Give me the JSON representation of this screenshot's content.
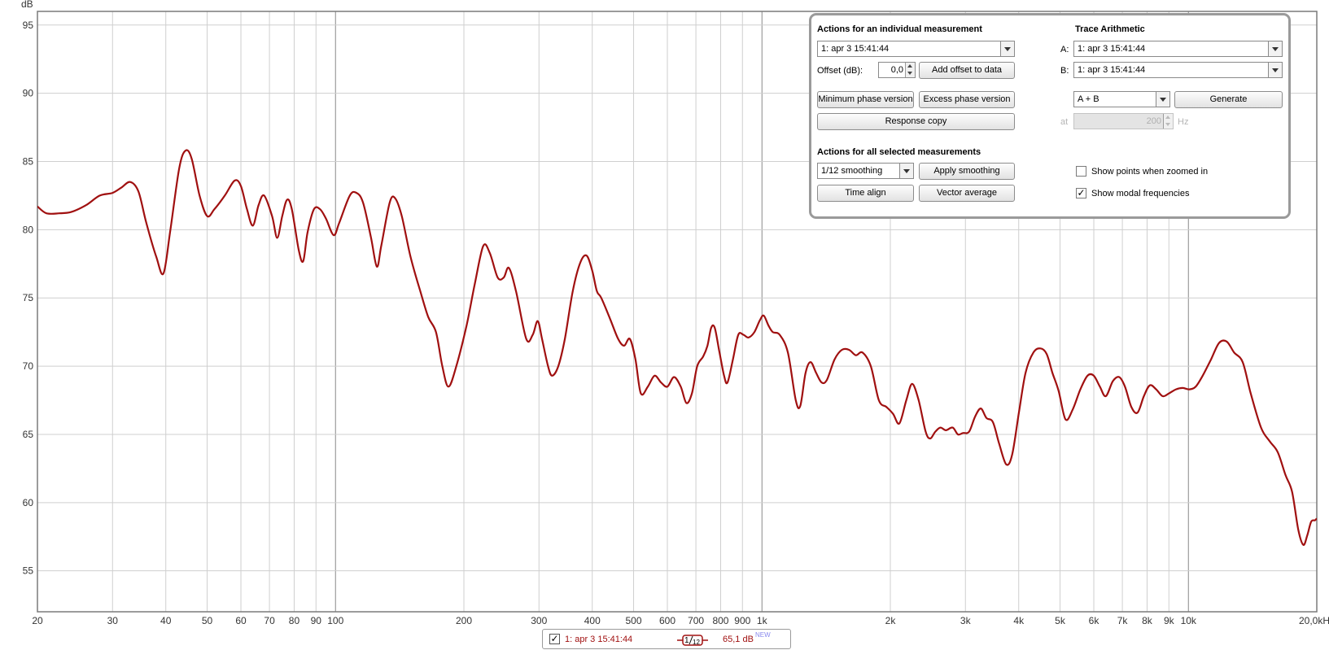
{
  "chart_data": {
    "type": "line",
    "title": "",
    "xlabel": "",
    "ylabel": "dB",
    "xscale": "log",
    "xlim": [
      20,
      20000
    ],
    "ylim": [
      52,
      96
    ],
    "grid": true,
    "x_tick_labels": [
      {
        "v": 20,
        "t": "20"
      },
      {
        "v": 30,
        "t": "30"
      },
      {
        "v": 40,
        "t": "40"
      },
      {
        "v": 50,
        "t": "50"
      },
      {
        "v": 60,
        "t": "60"
      },
      {
        "v": 70,
        "t": "70"
      },
      {
        "v": 80,
        "t": "80"
      },
      {
        "v": 90,
        "t": "90"
      },
      {
        "v": 100,
        "t": "100"
      },
      {
        "v": 200,
        "t": "200"
      },
      {
        "v": 300,
        "t": "300"
      },
      {
        "v": 400,
        "t": "400"
      },
      {
        "v": 500,
        "t": "500"
      },
      {
        "v": 600,
        "t": "600"
      },
      {
        "v": 700,
        "t": "700"
      },
      {
        "v": 800,
        "t": "800"
      },
      {
        "v": 900,
        "t": "900"
      },
      {
        "v": 1000,
        "t": "1k"
      },
      {
        "v": 2000,
        "t": "2k"
      },
      {
        "v": 3000,
        "t": "3k"
      },
      {
        "v": 4000,
        "t": "4k"
      },
      {
        "v": 5000,
        "t": "5k"
      },
      {
        "v": 6000,
        "t": "6k"
      },
      {
        "v": 7000,
        "t": "7k"
      },
      {
        "v": 8000,
        "t": "8k"
      },
      {
        "v": 9000,
        "t": "9k"
      },
      {
        "v": 10000,
        "t": "10k"
      },
      {
        "v": 20000,
        "t": "20,0kHz"
      }
    ],
    "y_ticks": [
      55,
      60,
      65,
      70,
      75,
      80,
      85,
      90,
      95
    ],
    "series": [
      {
        "name": "1: apr 3 15:41:44",
        "color": "#a01010",
        "points": [
          [
            20,
            81.7
          ],
          [
            21,
            81.2
          ],
          [
            22.5,
            81.2
          ],
          [
            24,
            81.3
          ],
          [
            26,
            81.8
          ],
          [
            28,
            82.5
          ],
          [
            30,
            82.7
          ],
          [
            31.5,
            83.1
          ],
          [
            33,
            83.5
          ],
          [
            34.5,
            82.8
          ],
          [
            36,
            80.5
          ],
          [
            38,
            78.0
          ],
          [
            39.5,
            76.8
          ],
          [
            41,
            80.0
          ],
          [
            43,
            84.5
          ],
          [
            44.5,
            85.8
          ],
          [
            46,
            85.2
          ],
          [
            48,
            82.5
          ],
          [
            50,
            81.0
          ],
          [
            52,
            81.5
          ],
          [
            55,
            82.5
          ],
          [
            58,
            83.6
          ],
          [
            60,
            83.2
          ],
          [
            62,
            81.5
          ],
          [
            64,
            80.3
          ],
          [
            66,
            81.8
          ],
          [
            68,
            82.5
          ],
          [
            71,
            81.0
          ],
          [
            73,
            79.4
          ],
          [
            75,
            81.0
          ],
          [
            77,
            82.2
          ],
          [
            79,
            81.5
          ],
          [
            82,
            78.5
          ],
          [
            84,
            77.7
          ],
          [
            86,
            79.8
          ],
          [
            89,
            81.5
          ],
          [
            92,
            81.5
          ],
          [
            95,
            80.8
          ],
          [
            99,
            79.6
          ],
          [
            102,
            80.5
          ],
          [
            108,
            82.5
          ],
          [
            112,
            82.7
          ],
          [
            116,
            82.0
          ],
          [
            121,
            79.5
          ],
          [
            125,
            77.3
          ],
          [
            128,
            78.8
          ],
          [
            134,
            82.0
          ],
          [
            138,
            82.3
          ],
          [
            143,
            81.0
          ],
          [
            150,
            78.0
          ],
          [
            158,
            75.5
          ],
          [
            165,
            73.6
          ],
          [
            172,
            72.5
          ],
          [
            178,
            70.0
          ],
          [
            184,
            68.5
          ],
          [
            192,
            70.0
          ],
          [
            203,
            73.0
          ],
          [
            212,
            76.0
          ],
          [
            222,
            78.8
          ],
          [
            230,
            78.3
          ],
          [
            240,
            76.5
          ],
          [
            248,
            76.5
          ],
          [
            255,
            77.2
          ],
          [
            265,
            75.5
          ],
          [
            280,
            72.0
          ],
          [
            290,
            72.3
          ],
          [
            298,
            73.3
          ],
          [
            305,
            72.0
          ],
          [
            315,
            70.0
          ],
          [
            322,
            69.3
          ],
          [
            333,
            70.0
          ],
          [
            345,
            72.0
          ],
          [
            360,
            75.5
          ],
          [
            375,
            77.6
          ],
          [
            388,
            78.1
          ],
          [
            400,
            77.0
          ],
          [
            410,
            75.5
          ],
          [
            420,
            75.0
          ],
          [
            440,
            73.5
          ],
          [
            460,
            72.0
          ],
          [
            475,
            71.5
          ],
          [
            490,
            72.0
          ],
          [
            505,
            70.5
          ],
          [
            520,
            68.0
          ],
          [
            540,
            68.5
          ],
          [
            560,
            69.3
          ],
          [
            580,
            68.8
          ],
          [
            600,
            68.5
          ],
          [
            622,
            69.2
          ],
          [
            645,
            68.5
          ],
          [
            665,
            67.3
          ],
          [
            685,
            68.0
          ],
          [
            705,
            70.0
          ],
          [
            728,
            70.7
          ],
          [
            745,
            71.5
          ],
          [
            760,
            72.8
          ],
          [
            775,
            72.8
          ],
          [
            795,
            71.0
          ],
          [
            815,
            69.3
          ],
          [
            830,
            68.8
          ],
          [
            855,
            70.5
          ],
          [
            880,
            72.3
          ],
          [
            905,
            72.3
          ],
          [
            930,
            72.1
          ],
          [
            960,
            72.5
          ],
          [
            990,
            73.4
          ],
          [
            1010,
            73.7
          ],
          [
            1035,
            73.0
          ],
          [
            1060,
            72.5
          ],
          [
            1100,
            72.3
          ],
          [
            1150,
            71.0
          ],
          [
            1200,
            67.5
          ],
          [
            1230,
            67.1
          ],
          [
            1265,
            69.5
          ],
          [
            1300,
            70.3
          ],
          [
            1340,
            69.5
          ],
          [
            1380,
            68.8
          ],
          [
            1420,
            69.0
          ],
          [
            1480,
            70.5
          ],
          [
            1540,
            71.2
          ],
          [
            1600,
            71.2
          ],
          [
            1660,
            70.8
          ],
          [
            1720,
            71.0
          ],
          [
            1800,
            70.0
          ],
          [
            1880,
            67.5
          ],
          [
            1960,
            67.0
          ],
          [
            2030,
            66.5
          ],
          [
            2100,
            65.8
          ],
          [
            2180,
            67.5
          ],
          [
            2250,
            68.7
          ],
          [
            2330,
            67.5
          ],
          [
            2420,
            65.2
          ],
          [
            2480,
            64.7
          ],
          [
            2550,
            65.2
          ],
          [
            2620,
            65.5
          ],
          [
            2700,
            65.3
          ],
          [
            2800,
            65.5
          ],
          [
            2880,
            65.0
          ],
          [
            2960,
            65.1
          ],
          [
            3060,
            65.2
          ],
          [
            3160,
            66.3
          ],
          [
            3260,
            66.9
          ],
          [
            3360,
            66.2
          ],
          [
            3480,
            65.9
          ],
          [
            3600,
            64.3
          ],
          [
            3740,
            62.8
          ],
          [
            3860,
            63.5
          ],
          [
            4000,
            66.5
          ],
          [
            4150,
            69.5
          ],
          [
            4330,
            71.0
          ],
          [
            4500,
            71.3
          ],
          [
            4650,
            70.9
          ],
          [
            4800,
            69.5
          ],
          [
            4960,
            68.2
          ],
          [
            5150,
            66.1
          ],
          [
            5350,
            66.8
          ],
          [
            5580,
            68.3
          ],
          [
            5800,
            69.3
          ],
          [
            6000,
            69.3
          ],
          [
            6200,
            68.5
          ],
          [
            6400,
            67.8
          ],
          [
            6650,
            68.9
          ],
          [
            6880,
            69.2
          ],
          [
            7100,
            68.5
          ],
          [
            7350,
            67.0
          ],
          [
            7600,
            66.6
          ],
          [
            7860,
            67.8
          ],
          [
            8120,
            68.6
          ],
          [
            8400,
            68.3
          ],
          [
            8700,
            67.8
          ],
          [
            9000,
            68.0
          ],
          [
            9350,
            68.3
          ],
          [
            9700,
            68.4
          ],
          [
            10050,
            68.3
          ],
          [
            10400,
            68.5
          ],
          [
            10800,
            69.3
          ],
          [
            11300,
            70.5
          ],
          [
            11800,
            71.7
          ],
          [
            12300,
            71.8
          ],
          [
            12800,
            71.0
          ],
          [
            13400,
            70.3
          ],
          [
            14000,
            68.0
          ],
          [
            14800,
            65.5
          ],
          [
            15500,
            64.5
          ],
          [
            16200,
            63.7
          ],
          [
            16900,
            62.0
          ],
          [
            17500,
            60.8
          ],
          [
            18100,
            58.0
          ],
          [
            18600,
            56.9
          ],
          [
            19000,
            57.6
          ],
          [
            19400,
            58.6
          ],
          [
            19800,
            58.7
          ],
          [
            20000,
            58.8
          ],
          [
            20350,
            58.6
          ],
          [
            20800,
            58.2
          ]
        ]
      }
    ]
  },
  "panel": {
    "individual_title": "Actions for an individual measurement",
    "measurement_select": "1: apr 3 15:41:44",
    "offset_label": "Offset (dB):",
    "offset_value": "0,0",
    "add_offset_button": "Add offset to data",
    "min_phase_button": "Minimum phase version",
    "excess_phase_button": "Excess phase version",
    "response_copy_button": "Response copy",
    "all_title": "Actions for all selected measurements",
    "smoothing_select": "1/12 smoothing",
    "apply_smoothing_button": "Apply smoothing",
    "time_align_button": "Time align",
    "vector_average_button": "Vector average",
    "trace_title": "Trace Arithmetic",
    "a_label": "A:",
    "a_select": "1: apr 3 15:41:44",
    "b_label": "B:",
    "b_select": "1: apr 3 15:41:44",
    "op_select": "A + B",
    "generate_button": "Generate",
    "at_label": "at",
    "at_value": "200",
    "hz_label": "Hz",
    "show_points_label": "Show points when zoomed in",
    "show_points_checked": false,
    "show_modal_label": "Show modal frequencies",
    "show_modal_checked": true
  },
  "legend": {
    "checked": true,
    "name": "1: apr 3 15:41:44",
    "smoothing_num": "1",
    "smoothing_den": "12",
    "value": "65,1 dB",
    "badge": "NEW"
  }
}
